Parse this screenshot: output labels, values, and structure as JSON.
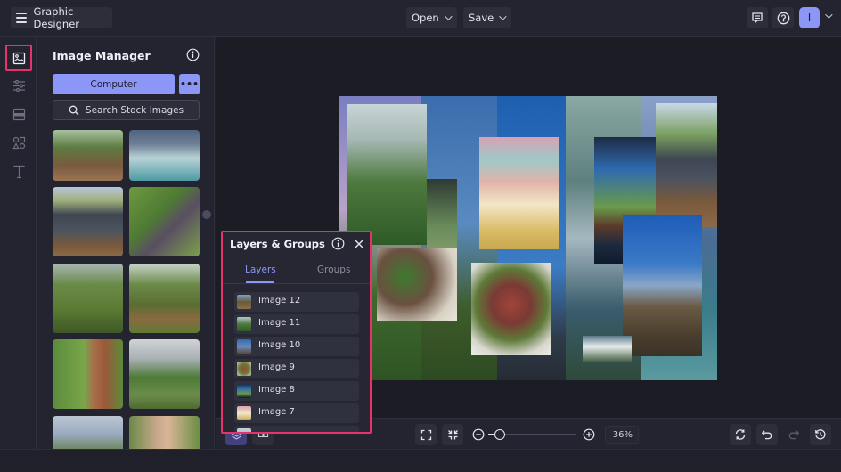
{
  "app": {
    "title": "Graphic Designer",
    "menu_open": "Open",
    "menu_save": "Save",
    "avatar_initial": "I",
    "accent_color": "#8c96f6",
    "highlight_color": "#e8336a"
  },
  "rail": {
    "items": [
      {
        "name": "image-manager",
        "active": true
      },
      {
        "name": "adjustments",
        "active": false
      },
      {
        "name": "layout",
        "active": false
      },
      {
        "name": "graphics",
        "active": false
      },
      {
        "name": "text",
        "active": false
      }
    ]
  },
  "image_manager": {
    "title": "Image Manager",
    "computer_label": "Computer",
    "more_label": "•••",
    "search_label": "Search Stock Images",
    "thumbnails": [
      "chickens-under-trees",
      "ocean-waves",
      "minivan-with-chicken",
      "garden-path",
      "forest-canopy",
      "large-tree",
      "tree-trunk",
      "valley-hiker",
      "mountain-sky",
      "selfie-arm-raised"
    ]
  },
  "layers_panel": {
    "title": "Layers & Groups",
    "tabs": [
      "Layers",
      "Groups"
    ],
    "active_tab": "Layers",
    "layers": [
      {
        "name": "Image 12"
      },
      {
        "name": "Image 11"
      },
      {
        "name": "Image 10"
      },
      {
        "name": "Image 9"
      },
      {
        "name": "Image 8"
      },
      {
        "name": "Image 7"
      }
    ]
  },
  "bottom_bar": {
    "zoom_value": "36%",
    "zoom_level_fraction": 0.0
  }
}
